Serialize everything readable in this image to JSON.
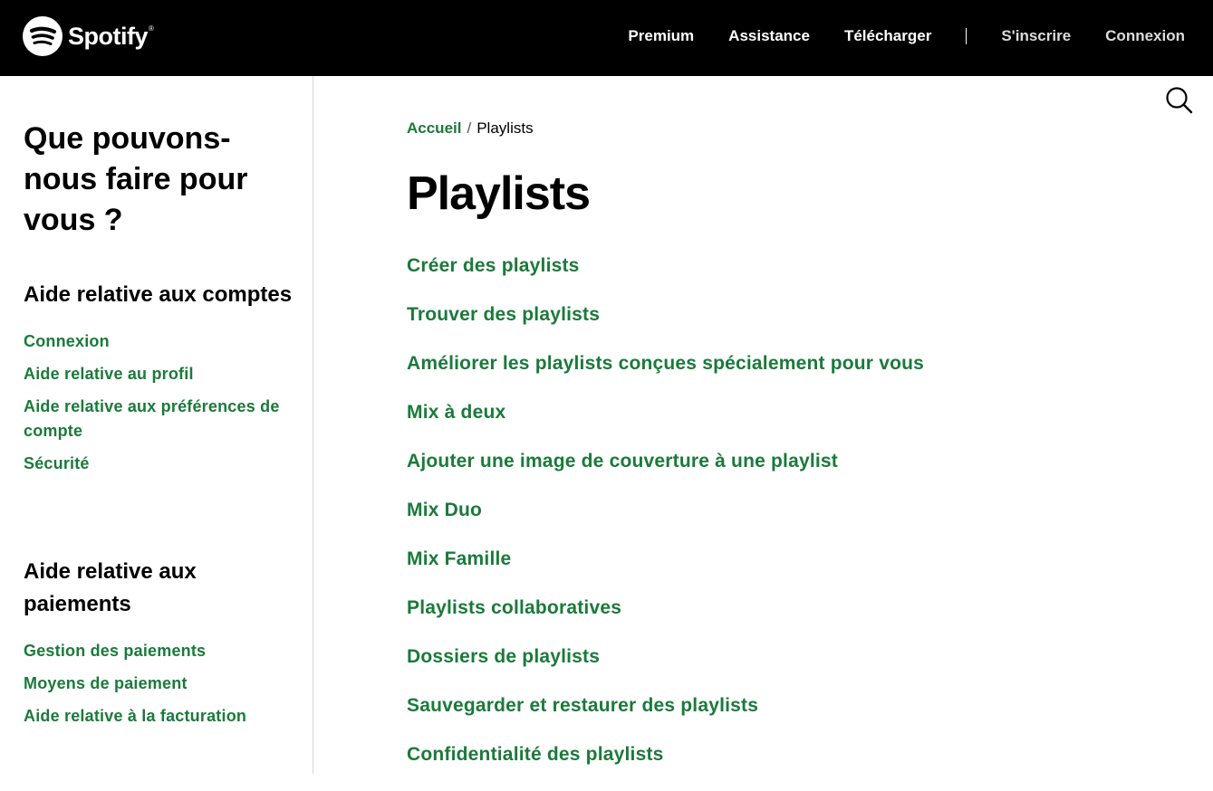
{
  "header": {
    "logo_text": "Spotify",
    "logo_reg": "®",
    "nav": [
      {
        "label": "Premium"
      },
      {
        "label": "Assistance"
      },
      {
        "label": "Télécharger"
      },
      {
        "label": "S'inscrire"
      },
      {
        "label": "Connexion"
      }
    ]
  },
  "sidebar": {
    "title": "Que pouvons-nous faire pour vous ?",
    "sections": [
      {
        "heading": "Aide relative aux comptes",
        "links": [
          "Connexion",
          "Aide relative au profil",
          "Aide relative aux préférences de compte",
          "Sécurité"
        ]
      },
      {
        "heading": "Aide relative aux paiements",
        "links": [
          "Gestion des paiements",
          "Moyens de paiement",
          "Aide relative à la facturation"
        ]
      }
    ]
  },
  "breadcrumb": {
    "home": "Accueil",
    "separator": "/",
    "current": "Playlists"
  },
  "main": {
    "title": "Playlists",
    "articles": [
      "Créer des playlists",
      "Trouver des playlists",
      "Améliorer les playlists conçues spécialement pour vous",
      "Mix à deux",
      "Ajouter une image de couverture à une playlist",
      "Mix Duo",
      "Mix Famille",
      "Playlists collaboratives",
      "Dossiers de playlists",
      "Sauvegarder et restaurer des playlists",
      "Confidentialité des playlists"
    ]
  },
  "colors": {
    "header_bg": "#000000",
    "link_green": "#1a7a3a",
    "divider": "#d9d9d9"
  },
  "icons": {
    "logo": "spotify-logo-icon",
    "search": "search-icon"
  }
}
